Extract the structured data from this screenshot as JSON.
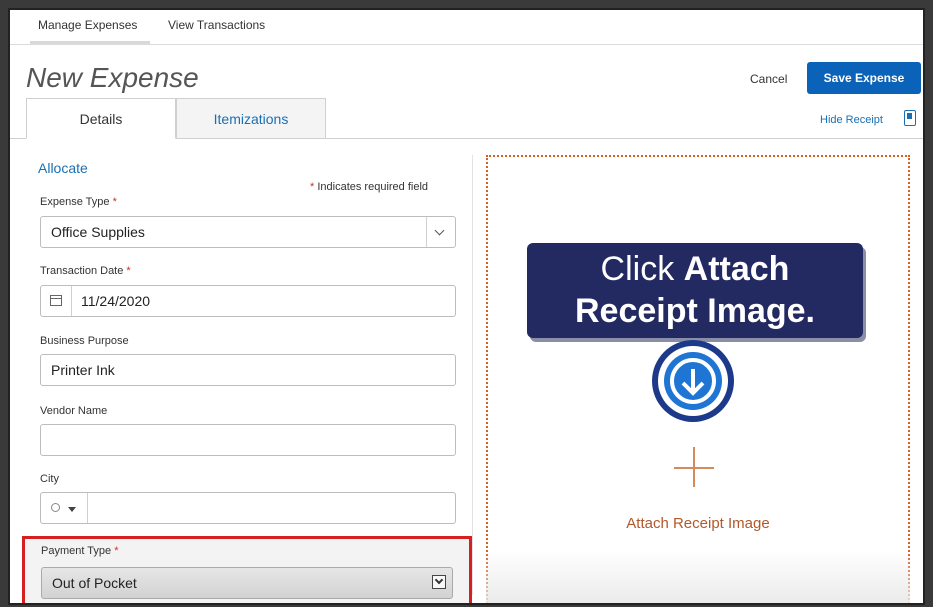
{
  "nav": {
    "manage_expenses": "Manage Expenses",
    "view_transactions": "View Transactions"
  },
  "header": {
    "title": "New Expense",
    "cancel": "Cancel",
    "save": "Save Expense",
    "hide_receipt": "Hide Receipt"
  },
  "tabs": [
    {
      "label": "Details"
    },
    {
      "label": "Itemizations"
    }
  ],
  "form": {
    "allocate": "Allocate",
    "required_note": "Indicates required field",
    "expense_type": {
      "label": "Expense Type",
      "value": "Office Supplies"
    },
    "transaction_date": {
      "label": "Transaction Date",
      "value": "11/24/2020"
    },
    "business_purpose": {
      "label": "Business Purpose",
      "value": "Printer Ink"
    },
    "vendor_name": {
      "label": "Vendor Name",
      "value": ""
    },
    "city": {
      "label": "City",
      "value": ""
    },
    "payment_type": {
      "label": "Payment Type",
      "value": "Out of Pocket"
    }
  },
  "receipt": {
    "callout_line1_a": "Click ",
    "callout_line1_b": "Attach",
    "callout_line2": "Receipt Image.",
    "attach_label": "Attach Receipt Image"
  },
  "colors": {
    "primary": "#0a63b8",
    "link": "#1a6fb3",
    "highlight": "#d6201f",
    "callout": "#232a62",
    "receipt_accent": "#d2602a"
  }
}
